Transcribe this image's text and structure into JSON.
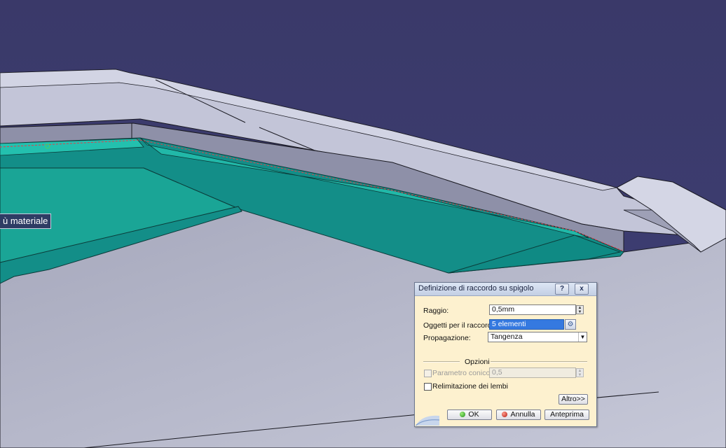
{
  "viewport": {
    "tooltip": "ù materiale",
    "colors": {
      "background": "#39396a",
      "part": "#c0c2d4",
      "face_selected": "#1ba898",
      "face_dark": "#0f7f78"
    }
  },
  "dialog": {
    "title": "Definizione di raccordo su spigolo",
    "help_label": "?",
    "close_label": "x",
    "radius": {
      "label": "Raggio:",
      "value": "0,5mm"
    },
    "objects": {
      "label": "Oggetti per il raccordo:",
      "value": "5 elementi"
    },
    "propagation": {
      "label": "Propagazione:",
      "value": "Tangenza"
    },
    "options_label": "Opzioni",
    "conic": {
      "label": "Parametro conico:",
      "value": "0,5"
    },
    "trim": {
      "label": "Relimitazione dei lembi"
    },
    "more_label": "Altro>>",
    "ok_label": "OK",
    "cancel_label": "Annulla",
    "preview_label": "Anteprima"
  }
}
